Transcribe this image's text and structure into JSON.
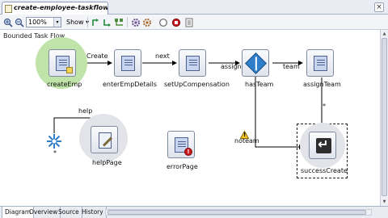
{
  "editor": {
    "file_tab": "create-employee-taskflow.xml",
    "close_glyph": "×"
  },
  "toolbar": {
    "zoom_value": "100%",
    "show_label": "Show",
    "dropdown_glyph": "▾"
  },
  "diagram": {
    "bounded_label": "Bounded Task Flow",
    "nodes": {
      "createEmp": "createEmp",
      "enterEmpDetails": "enterEmpDetails",
      "setUpCompensation": "setUpCompensation",
      "hasTeam": "hasTeam",
      "assignTeam": "assignTeam",
      "helpPage": "helpPage",
      "errorPage": "errorPage",
      "successCreate": "successCreate"
    },
    "edges": {
      "create": "Create",
      "next": "next",
      "assign": "assign",
      "team": "team",
      "help": "help",
      "noteam": "noteam",
      "wildcard_star": "*",
      "assignteam_star": "*"
    },
    "warning_glyph": "!"
  },
  "bottom_tabs": [
    "Diagram",
    "Overview",
    "Source",
    "History"
  ],
  "colors": {
    "default_activity_halo": "#bfe3a8",
    "router_icon": "#2e7ec9",
    "error_mark": "#c9141a",
    "edge": "#000000"
  }
}
